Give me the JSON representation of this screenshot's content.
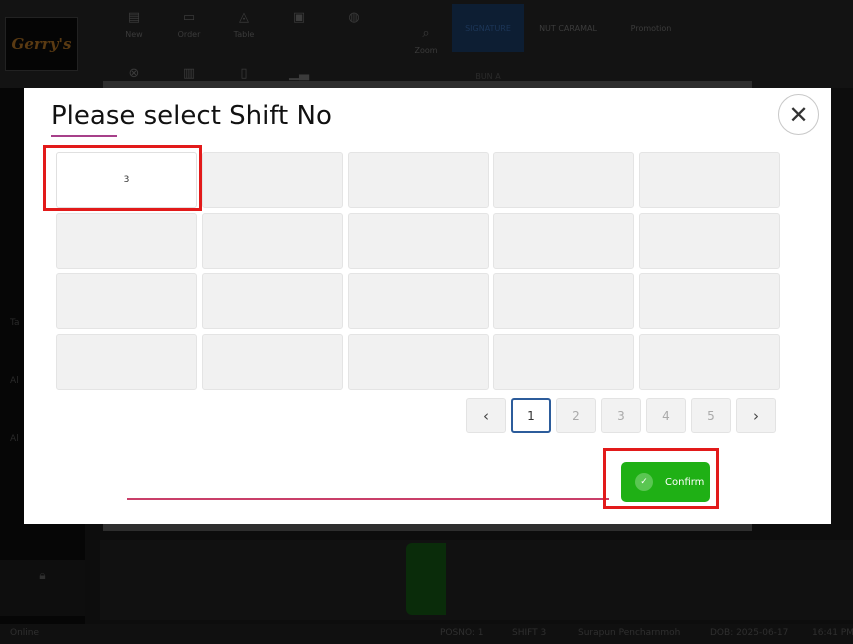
{
  "app": {
    "logo_text": "Gerry's",
    "toolbar": [
      {
        "label": "New",
        "icon": "document-icon"
      },
      {
        "label": "Order",
        "icon": "folder-icon"
      },
      {
        "label": "Table",
        "icon": "shapes-icon"
      },
      {
        "label": "",
        "icon": "printer-icon"
      },
      {
        "label": "",
        "icon": "printer2-icon"
      },
      {
        "label": "Zoom",
        "icon": "zoom-icon"
      }
    ],
    "toolbar_row2": [
      "circle-x-icon",
      "list-icon",
      "file-icon",
      "chart-icon"
    ],
    "tabs": [
      {
        "label": "SIGNATURE",
        "active": true
      },
      {
        "label": "NUT CARAMAL",
        "active": false
      },
      {
        "label": "Promotion",
        "active": false
      }
    ],
    "subtab": "BUN A",
    "sidebar_texts": [
      "Ta",
      "Al",
      "Al"
    ],
    "status": {
      "online": "Online",
      "posno": "POSNO: 1",
      "shift": "SHIFT 3",
      "user": "Surapun Pencharnmoh",
      "date": "DOB: 2025-06-17",
      "time": "16:41 PM"
    }
  },
  "modal": {
    "title": "Please select Shift No",
    "close_icon": "close-icon",
    "shift_cells": [
      "3",
      "",
      "",
      "",
      "",
      "",
      "",
      "",
      "",
      "",
      "",
      "",
      "",
      "",
      "",
      "",
      "",
      "",
      "",
      ""
    ],
    "pagination": {
      "prev": "‹",
      "next": "›",
      "pages": [
        "1",
        "2",
        "3",
        "4",
        "5"
      ],
      "active_page": "1"
    },
    "confirm_label": "Confirm",
    "accent_color": "#1fb015",
    "highlight_color": "#e21a1a"
  }
}
